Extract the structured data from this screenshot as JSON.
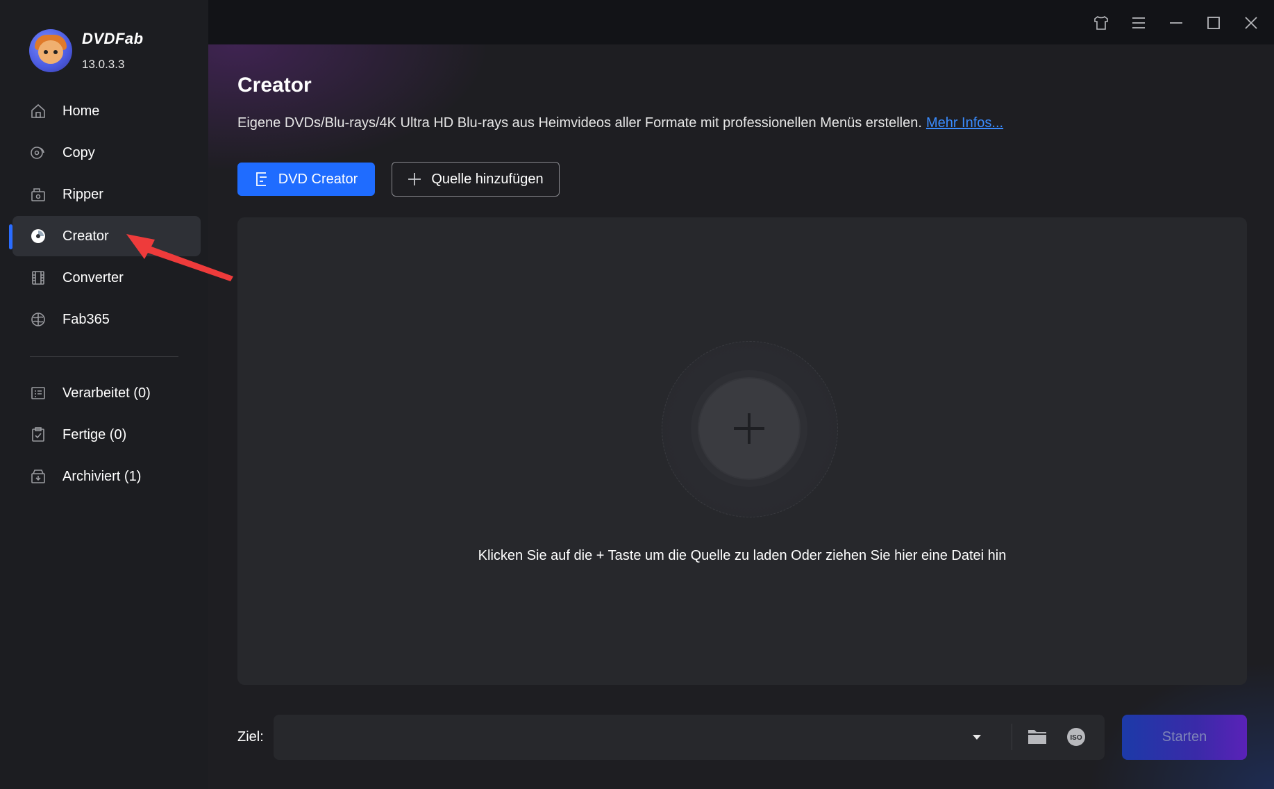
{
  "app": {
    "name": "DVDFab",
    "version": "13.0.3.3"
  },
  "sidebar": {
    "items": [
      {
        "label": "Home",
        "icon": "home-icon"
      },
      {
        "label": "Copy",
        "icon": "copy-disc-icon"
      },
      {
        "label": "Ripper",
        "icon": "ripper-icon"
      },
      {
        "label": "Creator",
        "icon": "creator-disc-icon",
        "active": true
      },
      {
        "label": "Converter",
        "icon": "film-icon"
      },
      {
        "label": "Fab365",
        "icon": "fab365-icon"
      }
    ],
    "queue": [
      {
        "label": "Verarbeitet (0)",
        "icon": "processing-list-icon"
      },
      {
        "label": "Fertige (0)",
        "icon": "clipboard-check-icon"
      },
      {
        "label": "Archiviert (1)",
        "icon": "archive-box-icon"
      }
    ]
  },
  "window_controls": [
    "shirt-skin-icon",
    "menu-icon",
    "minimize-icon",
    "maximize-icon",
    "close-icon"
  ],
  "main": {
    "title": "Creator",
    "description": "Eigene DVDs/Blu-rays/4K Ultra HD Blu-rays aus Heimvideos aller Formate mit professionellen Menüs erstellen.",
    "more_link": "Mehr Infos...",
    "mode_button": "DVD Creator",
    "add_source_button": "Quelle hinzufügen",
    "drop_hint": "Klicken Sie auf die + Taste um die Quelle zu laden Oder ziehen Sie hier eine Datei hin"
  },
  "footer": {
    "ziel_label": "Ziel:",
    "ziel_value": "",
    "start_button": "Starten"
  },
  "colors": {
    "accent": "#1f6cff",
    "sidebar_bg": "#1c1d21",
    "main_bg": "#1e1e22",
    "link": "#3a8cff",
    "annotation_arrow": "#f04040"
  }
}
